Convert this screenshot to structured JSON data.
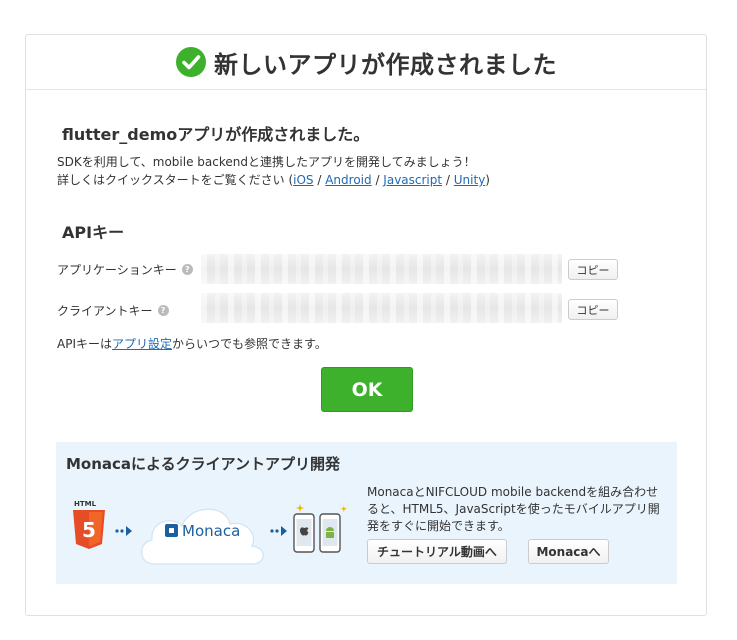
{
  "header": {
    "title": "新しいアプリが作成されました"
  },
  "body": {
    "app_created": "flutter_demoアプリが作成されました。",
    "intro_line1": "SDKを利用して、mobile backendと連携したアプリを開発してみましょう！",
    "intro_line2_prefix": "詳しくはクイックスタートをご覧ください (",
    "sdk_links": [
      "iOS",
      "Android",
      "Javascript",
      "Unity"
    ],
    "link_separator": " / ",
    "intro_line2_suffix": ")"
  },
  "api_keys": {
    "heading": "APIキー",
    "application_key_label": "アプリケーションキー",
    "client_key_label": "クライアントキー",
    "help_icon_glyph": "?",
    "copy_label": "コピー",
    "note_prefix": "APIキーは",
    "note_link": "アプリ設定",
    "note_suffix": "からいつでも参照できます。"
  },
  "ok_label": "OK",
  "monaca": {
    "title": "Monacaによるクライアントアプリ開発",
    "html_label": "HTML",
    "html_badge": "5",
    "logo_text": "Monaca",
    "description": "MonacaとNIFCLOUD mobile backendを組み合わせると、HTML5、JavaScriptを使ったモバイルアプリ開発をすぐに開始できます。",
    "tutorial_button": "チュートリアル動画へ",
    "monaca_button": "Monacaへ"
  },
  "colors": {
    "success_green": "#3db02c",
    "link_blue": "#1e6ab3",
    "monaca_panel_bg": "#eaf4fc",
    "html5_orange": "#e44d26",
    "monaca_blue": "#1c5f9e"
  },
  "icons": [
    "check-circle-icon",
    "help-icon",
    "html5-icon",
    "monaca-cloud-icon",
    "arrow-right-icon",
    "phones-icon"
  ]
}
